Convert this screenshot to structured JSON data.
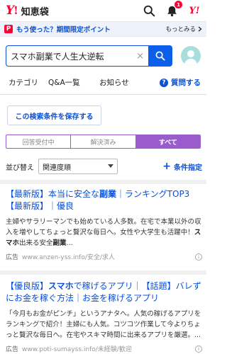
{
  "header": {
    "logo_mark": "Y",
    "logo_excl": "!",
    "logo_text": "知恵袋",
    "notification_count": "1",
    "yahoo_small": "Y!"
  },
  "promo": {
    "badge": "P",
    "text": "もう使った？期間限定ポイント",
    "more": "もっとみる"
  },
  "search": {
    "value": "スマホ副業で人生大逆転",
    "clear": "×"
  },
  "nav": {
    "items": [
      "カテゴリ",
      "Q&A一覧",
      "お知らせ"
    ],
    "ask_label": "質問する",
    "ask_icon": "?"
  },
  "save_condition": "この検索条件を保存する",
  "status_tabs": [
    "回答受付中",
    "解決済み",
    "すべて"
  ],
  "sort": {
    "label": "並び替え",
    "selected": "関連度順",
    "condition_label": "条件指定"
  },
  "ads": [
    {
      "title_1": "【最新版】本当に安全な",
      "title_bold": "副業",
      "title_2": "｜ランキングTOP3【最新版】｜優良",
      "desc_1": "主婦やサラリーマンでも始めている人多数。在宅で本業以外の収入を増やしてちょっと贅沢な毎日へ。女性や大学生も活躍中！",
      "desc_bold": "スマホ",
      "desc_2": "出来る安全",
      "desc_bold2": "副業",
      "desc_3": "...",
      "label": "広告",
      "url": "www.anzen-yss.info/安全/求人"
    },
    {
      "title_1": "【優良版】",
      "title_bold": "スマホ",
      "title_2": "で稼げるアプリ｜【話題】バレずにお金を稼ぐ方法｜お金を稼げるアプリ",
      "desc_1": "「今月もお金がピンチ」というアナタへ。人気の稼げるアプリをランキングで紹介！主婦にも人気。コツコツ作業して今よりちょっと贅沢な毎日へ。在宅やスキマ時間に出来るアプリを厳選。",
      "desc_bold": "",
      "desc_2": "",
      "desc_bold2": "",
      "desc_3": "...",
      "label": "広告",
      "url": "www.poti-sumayss.info/未経験/歓迎"
    }
  ],
  "colors": {
    "brand_red": "#ff0033",
    "link_blue": "#0b4fd8",
    "tab_purple": "#9a5ccc",
    "search_button": "#0b5fe8"
  }
}
